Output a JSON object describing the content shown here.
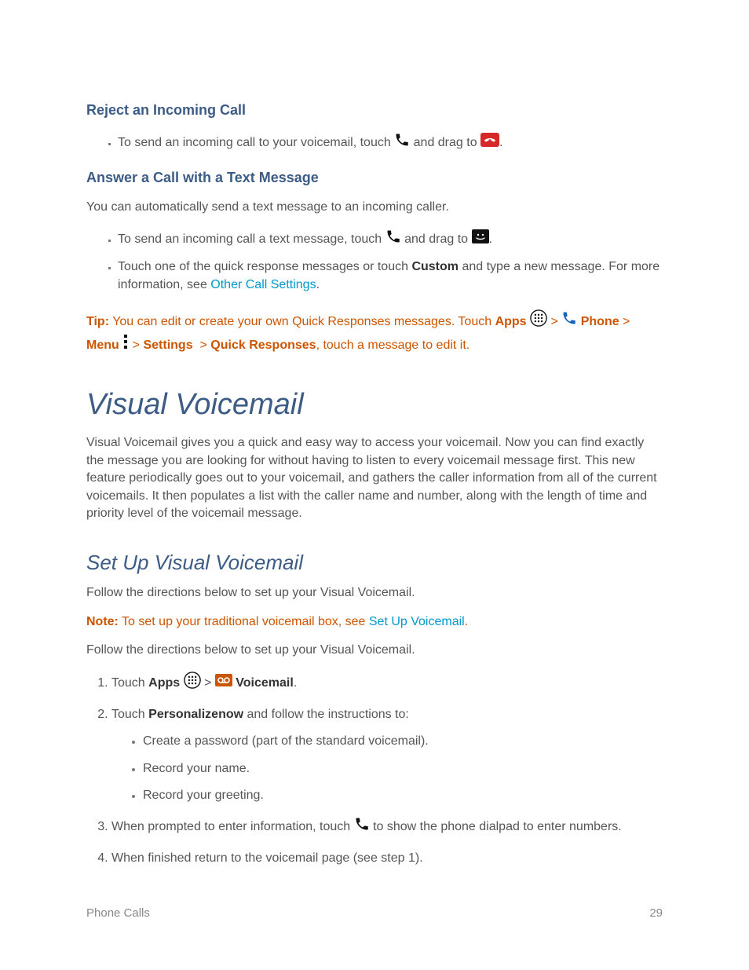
{
  "sections": {
    "reject": {
      "heading": "Reject an Incoming Call",
      "bullet_pre": "To send an incoming call to your voicemail, touch ",
      "bullet_mid": "and drag to ",
      "bullet_end": "."
    },
    "answer": {
      "heading": "Answer a Call with a Text Message",
      "intro": "You can automatically send a text message to an incoming caller.",
      "b1_pre": "To send an incoming call a text message, touch ",
      "b1_mid": "and drag to ",
      "b1_end": ".",
      "b2_pre": "Touch one of the quick response messages or touch ",
      "b2_custom": "Custom",
      "b2_mid": " and type a new message. For more information, see ",
      "b2_link": "Other Call Settings",
      "b2_end": "."
    },
    "tip": {
      "label": "Tip:",
      "t1": " You can edit or create your own Quick Responses messages. Touch ",
      "apps": "Apps",
      "gt": " > ",
      "phone": "Phone",
      "menu": "Menu",
      "settings": "Settings",
      "quick": "Quick Responses",
      "t2": ", touch a message to edit it."
    },
    "vv": {
      "heading": "Visual Voicemail",
      "para": "Visual Voicemail gives you a quick and easy way to access your voicemail. Now you can find exactly the message you are looking for without having to listen to every voicemail message first. This new feature periodically goes out to your voicemail, and gathers the caller information from all of the current voicemails. It then populates a list with the caller name and number, along with the length of time and priority level of the voicemail message."
    },
    "setup": {
      "heading": "Set Up Visual Voicemail",
      "intro1": "Follow the directions below to set up your Visual Voicemail.",
      "note_label": "Note:",
      "note_text": " To set up your traditional voicemail box, see ",
      "note_link": "Set Up Voicemail",
      "note_end": ".",
      "intro2": "Follow the directions below to set up your Visual Voicemail.",
      "s1_pre": "Touch ",
      "s1_apps": "Apps",
      "s1_gt": " > ",
      "s1_vm": "Voicemail",
      "s1_end": ".",
      "s2_pre": "Touch ",
      "s2_pn": "Personalizenow",
      "s2_post": " and follow the instructions to:",
      "s2_a": "Create a password (part of the standard voicemail).",
      "s2_b": "Record your name.",
      "s2_c": "Record your greeting.",
      "s3_pre": "When prompted to enter information, touch ",
      "s3_post": "to show the phone dialpad to enter numbers.",
      "s4": "When finished return to the voicemail page (see step 1)."
    }
  },
  "footer": {
    "left": "Phone Calls",
    "right": "29"
  }
}
